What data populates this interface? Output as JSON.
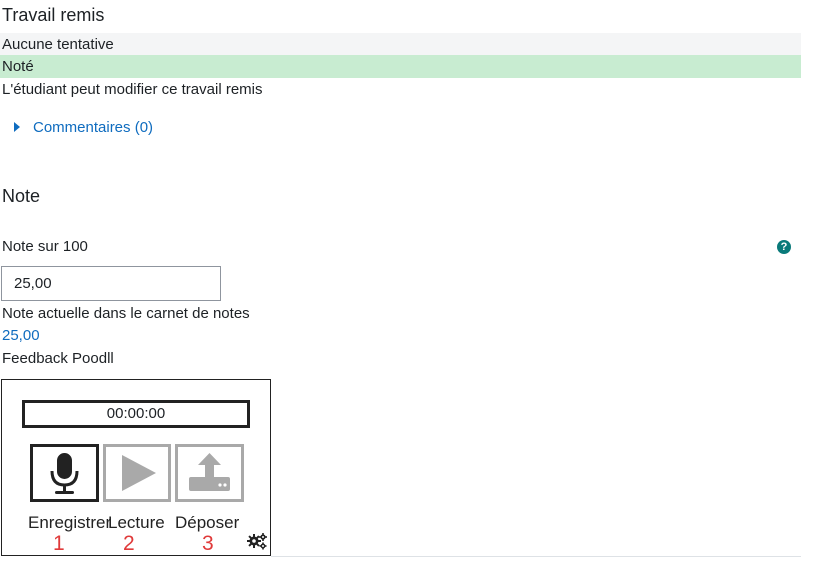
{
  "submission": {
    "heading": "Travail remis",
    "rows": [
      "Aucune tentative",
      "Noté",
      "L'étudiant peut modifier ce travail remis"
    ],
    "graded_color": "#c8ecd1",
    "comments_label": "Commentaires (0)"
  },
  "grade": {
    "heading": "Note",
    "label": "Note sur 100",
    "value": "25,00",
    "current_label": "Note actuelle dans le carnet de notes",
    "current_value": "25,00",
    "help_icon": "?"
  },
  "feedback": {
    "label": "Feedback Poodll",
    "timer": "00:00:00",
    "buttons": [
      {
        "icon": "microphone-icon",
        "label": "Enregistrer",
        "number": "1"
      },
      {
        "icon": "play-icon",
        "label": "Lecture",
        "number": "2"
      },
      {
        "icon": "upload-icon",
        "label": "Déposer",
        "number": "3"
      }
    ],
    "settings_icon": "gears-icon"
  }
}
